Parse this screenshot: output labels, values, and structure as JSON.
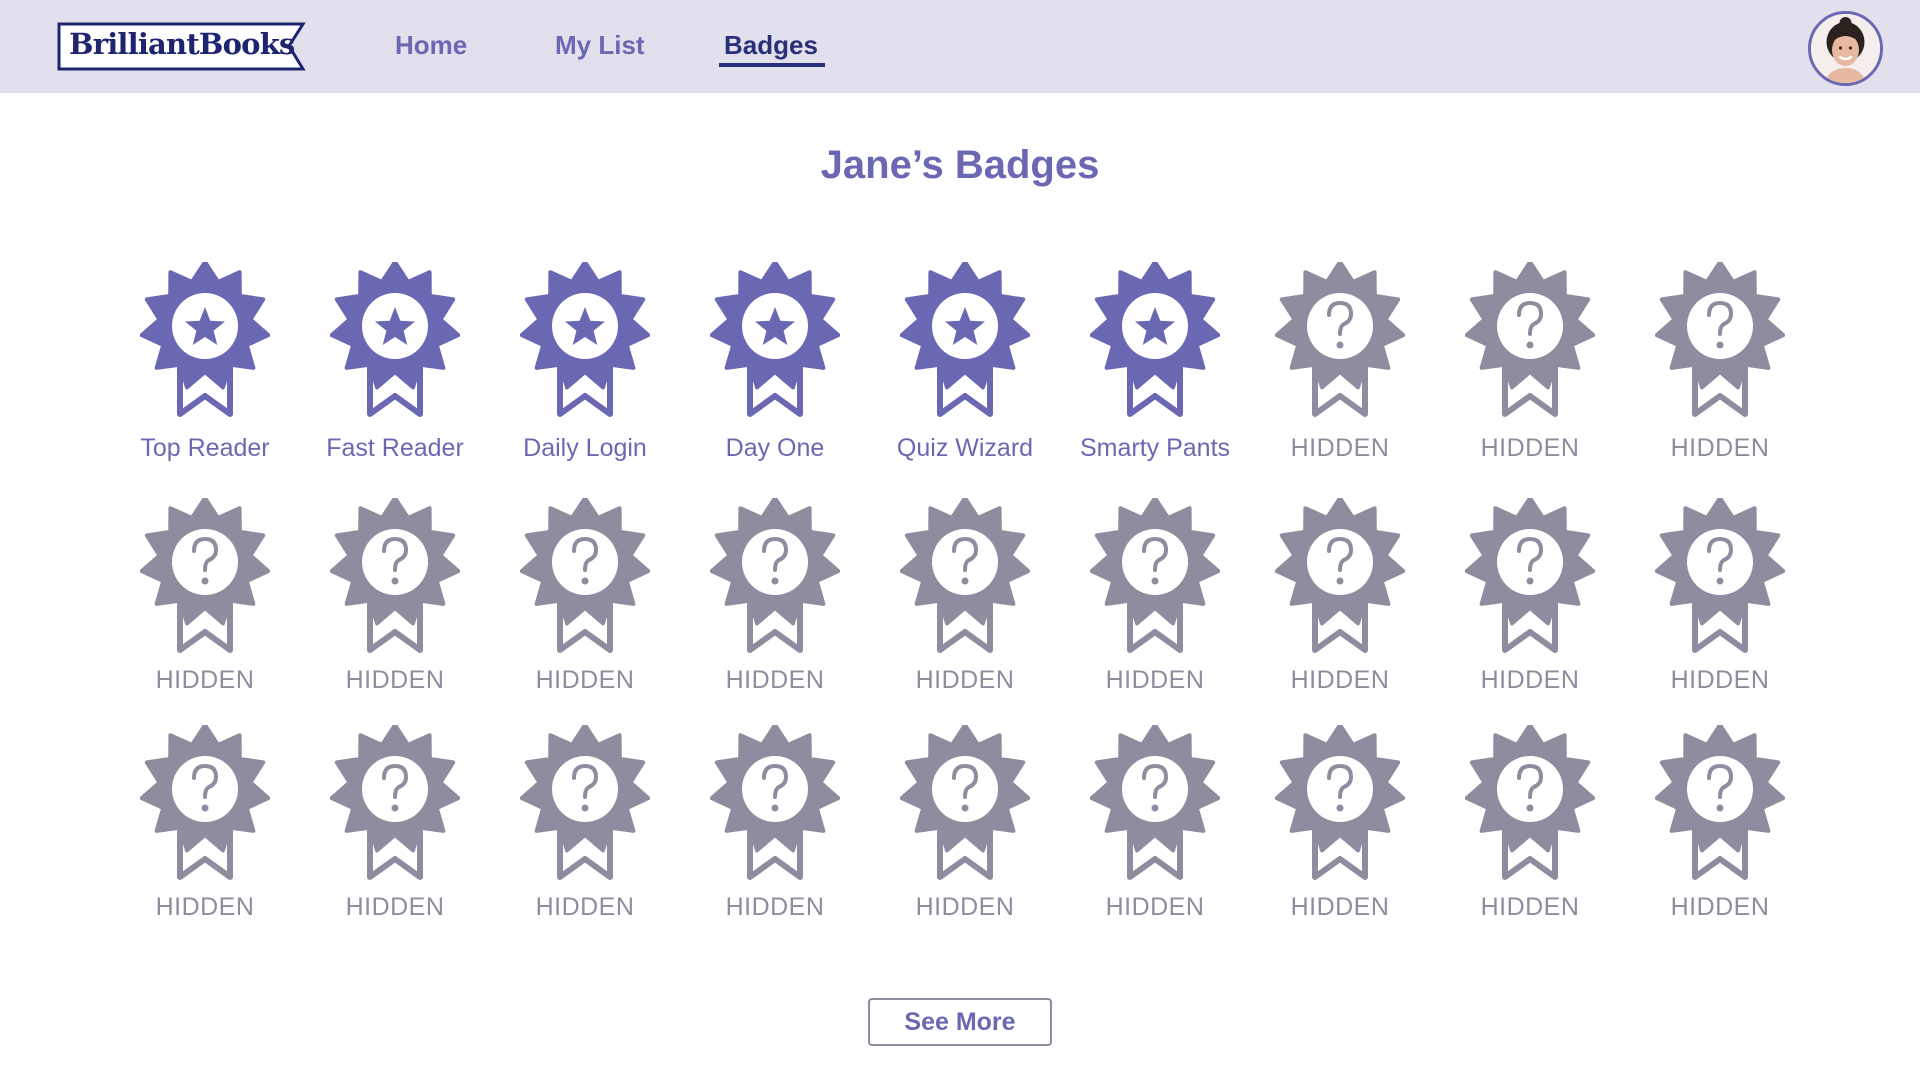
{
  "brand": {
    "name": "BrilliantBooks"
  },
  "nav": {
    "items": [
      {
        "label": "Home",
        "active": false
      },
      {
        "label": "My List",
        "active": false
      },
      {
        "label": "Badges",
        "active": true
      }
    ]
  },
  "user": {
    "avatar_icon": "user-avatar"
  },
  "page": {
    "title": "Jane’s Badges"
  },
  "colors": {
    "earned": "#6b68b3",
    "locked": "#8e8d9f",
    "topbar": "#e2e0ec",
    "brand_text": "#1f2470"
  },
  "badges": [
    {
      "label": "Top Reader",
      "earned": true,
      "icon": "star-badge-icon"
    },
    {
      "label": "Fast Reader",
      "earned": true,
      "icon": "star-badge-icon"
    },
    {
      "label": "Daily Login",
      "earned": true,
      "icon": "star-badge-icon"
    },
    {
      "label": "Day One",
      "earned": true,
      "icon": "star-badge-icon"
    },
    {
      "label": "Quiz Wizard",
      "earned": true,
      "icon": "star-badge-icon"
    },
    {
      "label": "Smarty Pants",
      "earned": true,
      "icon": "star-badge-icon"
    },
    {
      "label": "HIDDEN",
      "earned": false,
      "icon": "question-badge-icon"
    },
    {
      "label": "HIDDEN",
      "earned": false,
      "icon": "question-badge-icon"
    },
    {
      "label": "HIDDEN",
      "earned": false,
      "icon": "question-badge-icon"
    },
    {
      "label": "HIDDEN",
      "earned": false,
      "icon": "question-badge-icon"
    },
    {
      "label": "HIDDEN",
      "earned": false,
      "icon": "question-badge-icon"
    },
    {
      "label": "HIDDEN",
      "earned": false,
      "icon": "question-badge-icon"
    },
    {
      "label": "HIDDEN",
      "earned": false,
      "icon": "question-badge-icon"
    },
    {
      "label": "HIDDEN",
      "earned": false,
      "icon": "question-badge-icon"
    },
    {
      "label": "HIDDEN",
      "earned": false,
      "icon": "question-badge-icon"
    },
    {
      "label": "HIDDEN",
      "earned": false,
      "icon": "question-badge-icon"
    },
    {
      "label": "HIDDEN",
      "earned": false,
      "icon": "question-badge-icon"
    },
    {
      "label": "HIDDEN",
      "earned": false,
      "icon": "question-badge-icon"
    },
    {
      "label": "HIDDEN",
      "earned": false,
      "icon": "question-badge-icon"
    },
    {
      "label": "HIDDEN",
      "earned": false,
      "icon": "question-badge-icon"
    },
    {
      "label": "HIDDEN",
      "earned": false,
      "icon": "question-badge-icon"
    },
    {
      "label": "HIDDEN",
      "earned": false,
      "icon": "question-badge-icon"
    },
    {
      "label": "HIDDEN",
      "earned": false,
      "icon": "question-badge-icon"
    },
    {
      "label": "HIDDEN",
      "earned": false,
      "icon": "question-badge-icon"
    },
    {
      "label": "HIDDEN",
      "earned": false,
      "icon": "question-badge-icon"
    },
    {
      "label": "HIDDEN",
      "earned": false,
      "icon": "question-badge-icon"
    },
    {
      "label": "HIDDEN",
      "earned": false,
      "icon": "question-badge-icon"
    }
  ],
  "actions": {
    "see_more_label": "See More"
  }
}
